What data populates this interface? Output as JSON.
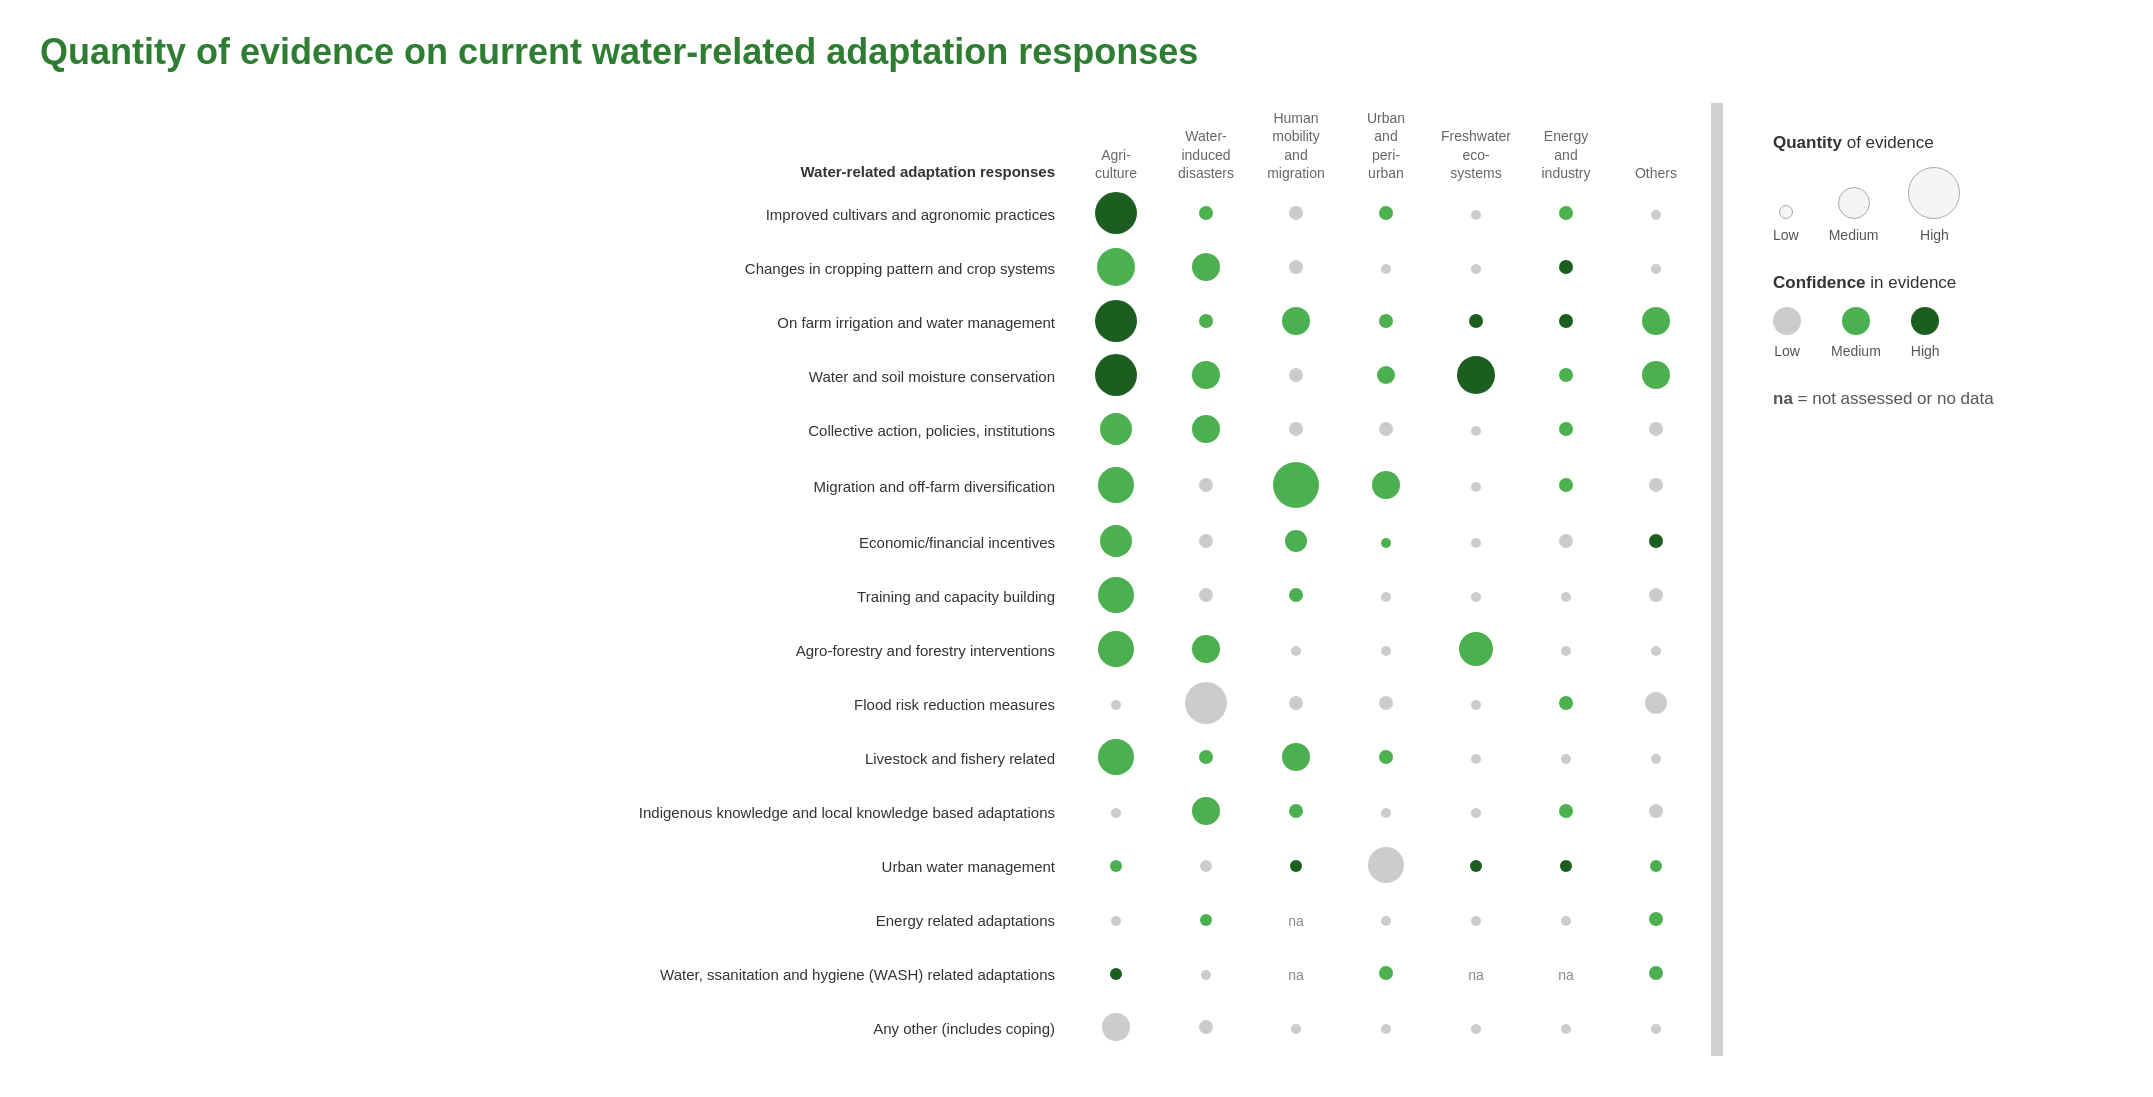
{
  "title": "Quantity of evidence on current water-related adaptation responses",
  "columns": [
    {
      "id": "agri",
      "label": "Agri-\nculture"
    },
    {
      "id": "water_disasters",
      "label": "Water-\ninduced\ndisasters"
    },
    {
      "id": "human_mobility",
      "label": "Human\nmobility\nand\nmigration"
    },
    {
      "id": "urban",
      "label": "Urban\nand\nperi-\nurban"
    },
    {
      "id": "freshwater",
      "label": "Freshwater\neco-\nsystems"
    },
    {
      "id": "energy",
      "label": "Energy\nand\nindustry"
    },
    {
      "id": "others",
      "label": "Others"
    }
  ],
  "row_label_header": "Water-related adaptation responses",
  "rows": [
    {
      "label": "Improved cultivars and agronomic practices",
      "cells": [
        {
          "size": 42,
          "color": "dark-green"
        },
        {
          "size": 14,
          "color": "medium-green"
        },
        {
          "size": 14,
          "color": "light-gray"
        },
        {
          "size": 14,
          "color": "medium-green"
        },
        {
          "size": 10,
          "color": "light-gray"
        },
        {
          "size": 14,
          "color": "medium-green"
        },
        {
          "size": 10,
          "color": "light-gray"
        }
      ]
    },
    {
      "label": "Changes in cropping pattern and crop systems",
      "cells": [
        {
          "size": 38,
          "color": "medium-green"
        },
        {
          "size": 28,
          "color": "medium-green"
        },
        {
          "size": 14,
          "color": "light-gray"
        },
        {
          "size": 10,
          "color": "light-gray"
        },
        {
          "size": 10,
          "color": "light-gray"
        },
        {
          "size": 14,
          "color": "dark-green"
        },
        {
          "size": 10,
          "color": "light-gray"
        }
      ]
    },
    {
      "label": "On farm irrigation and water management",
      "cells": [
        {
          "size": 42,
          "color": "dark-green"
        },
        {
          "size": 14,
          "color": "medium-green"
        },
        {
          "size": 28,
          "color": "medium-green"
        },
        {
          "size": 14,
          "color": "medium-green"
        },
        {
          "size": 14,
          "color": "dark-green"
        },
        {
          "size": 14,
          "color": "dark-green"
        },
        {
          "size": 28,
          "color": "medium-green"
        }
      ]
    },
    {
      "label": "Water and soil moisture conservation",
      "cells": [
        {
          "size": 42,
          "color": "dark-green"
        },
        {
          "size": 28,
          "color": "medium-green"
        },
        {
          "size": 14,
          "color": "light-gray"
        },
        {
          "size": 18,
          "color": "medium-green"
        },
        {
          "size": 38,
          "color": "dark-green"
        },
        {
          "size": 14,
          "color": "medium-green"
        },
        {
          "size": 28,
          "color": "medium-green"
        }
      ]
    },
    {
      "label": "Collective action, policies, institutions",
      "cells": [
        {
          "size": 32,
          "color": "medium-green"
        },
        {
          "size": 28,
          "color": "medium-green"
        },
        {
          "size": 14,
          "color": "light-gray"
        },
        {
          "size": 14,
          "color": "light-gray"
        },
        {
          "size": 10,
          "color": "light-gray"
        },
        {
          "size": 14,
          "color": "medium-green"
        },
        {
          "size": 14,
          "color": "light-gray"
        }
      ]
    },
    {
      "label": "Migration and off-farm diversification",
      "cells": [
        {
          "size": 36,
          "color": "medium-green"
        },
        {
          "size": 14,
          "color": "light-gray"
        },
        {
          "size": 46,
          "color": "medium-green"
        },
        {
          "size": 28,
          "color": "medium-green"
        },
        {
          "size": 10,
          "color": "light-gray"
        },
        {
          "size": 14,
          "color": "medium-green"
        },
        {
          "size": 14,
          "color": "light-gray"
        }
      ]
    },
    {
      "label": "Economic/financial incentives",
      "cells": [
        {
          "size": 32,
          "color": "medium-green"
        },
        {
          "size": 14,
          "color": "light-gray"
        },
        {
          "size": 22,
          "color": "medium-green"
        },
        {
          "size": 10,
          "color": "medium-green"
        },
        {
          "size": 10,
          "color": "light-gray"
        },
        {
          "size": 14,
          "color": "light-gray"
        },
        {
          "size": 14,
          "color": "dark-green"
        }
      ]
    },
    {
      "label": "Training and capacity building",
      "cells": [
        {
          "size": 36,
          "color": "medium-green"
        },
        {
          "size": 14,
          "color": "light-gray"
        },
        {
          "size": 14,
          "color": "medium-green"
        },
        {
          "size": 10,
          "color": "light-gray"
        },
        {
          "size": 10,
          "color": "light-gray"
        },
        {
          "size": 10,
          "color": "light-gray"
        },
        {
          "size": 14,
          "color": "light-gray"
        }
      ]
    },
    {
      "label": "Agro-forestry and forestry interventions",
      "cells": [
        {
          "size": 36,
          "color": "medium-green"
        },
        {
          "size": 28,
          "color": "medium-green"
        },
        {
          "size": 10,
          "color": "light-gray"
        },
        {
          "size": 10,
          "color": "light-gray"
        },
        {
          "size": 34,
          "color": "medium-green"
        },
        {
          "size": 10,
          "color": "light-gray"
        },
        {
          "size": 10,
          "color": "light-gray"
        }
      ]
    },
    {
      "label": "Flood risk reduction measures",
      "cells": [
        {
          "size": 10,
          "color": "light-gray"
        },
        {
          "size": 42,
          "color": "light-gray"
        },
        {
          "size": 14,
          "color": "light-gray"
        },
        {
          "size": 14,
          "color": "light-gray"
        },
        {
          "size": 10,
          "color": "light-gray"
        },
        {
          "size": 14,
          "color": "medium-green"
        },
        {
          "size": 22,
          "color": "light-gray"
        }
      ]
    },
    {
      "label": "Livestock and fishery related",
      "cells": [
        {
          "size": 36,
          "color": "medium-green"
        },
        {
          "size": 14,
          "color": "medium-green"
        },
        {
          "size": 28,
          "color": "medium-green"
        },
        {
          "size": 14,
          "color": "medium-green"
        },
        {
          "size": 10,
          "color": "light-gray"
        },
        {
          "size": 10,
          "color": "light-gray"
        },
        {
          "size": 10,
          "color": "light-gray"
        }
      ]
    },
    {
      "label": "Indigenous knowledge and local knowledge based adaptations",
      "cells": [
        {
          "size": 10,
          "color": "light-gray"
        },
        {
          "size": 28,
          "color": "medium-green"
        },
        {
          "size": 14,
          "color": "medium-green"
        },
        {
          "size": 10,
          "color": "light-gray"
        },
        {
          "size": 10,
          "color": "light-gray"
        },
        {
          "size": 14,
          "color": "medium-green"
        },
        {
          "size": 14,
          "color": "light-gray"
        }
      ]
    },
    {
      "label": "Urban water management",
      "cells": [
        {
          "size": 12,
          "color": "medium-green"
        },
        {
          "size": 12,
          "color": "light-gray"
        },
        {
          "size": 12,
          "color": "dark-green"
        },
        {
          "size": 36,
          "color": "light-gray"
        },
        {
          "size": 12,
          "color": "dark-green"
        },
        {
          "size": 12,
          "color": "dark-green"
        },
        {
          "size": 12,
          "color": "medium-green"
        }
      ]
    },
    {
      "label": "Energy related adaptations",
      "cells": [
        {
          "size": 10,
          "color": "light-gray"
        },
        {
          "size": 12,
          "color": "medium-green"
        },
        {
          "na": true
        },
        {
          "size": 10,
          "color": "light-gray"
        },
        {
          "size": 10,
          "color": "light-gray"
        },
        {
          "size": 10,
          "color": "light-gray"
        },
        {
          "size": 14,
          "color": "medium-green"
        }
      ]
    },
    {
      "label": "Water, ssanitation and hygiene (WASH) related adaptations",
      "cells": [
        {
          "size": 12,
          "color": "dark-green"
        },
        {
          "size": 10,
          "color": "light-gray"
        },
        {
          "na": true
        },
        {
          "size": 14,
          "color": "medium-green"
        },
        {
          "na": true
        },
        {
          "na": true
        },
        {
          "size": 14,
          "color": "medium-green"
        }
      ]
    },
    {
      "label": "Any other (includes coping)",
      "cells": [
        {
          "size": 28,
          "color": "light-gray"
        },
        {
          "size": 14,
          "color": "light-gray"
        },
        {
          "size": 10,
          "color": "light-gray"
        },
        {
          "size": 10,
          "color": "light-gray"
        },
        {
          "size": 10,
          "color": "light-gray"
        },
        {
          "size": 10,
          "color": "light-gray"
        },
        {
          "size": 10,
          "color": "light-gray"
        }
      ]
    }
  ],
  "legend": {
    "quantity_title": "Quantity",
    "quantity_subtitle": " of evidence",
    "quantity_items": [
      {
        "label": "Low",
        "size": 14
      },
      {
        "label": "Medium",
        "size": 32
      },
      {
        "label": "High",
        "size": 52
      }
    ],
    "confidence_title": "Confidence",
    "confidence_subtitle": " in evidence",
    "confidence_items": [
      {
        "label": "Low",
        "color": "light-gray",
        "size": 28
      },
      {
        "label": "Medium",
        "color": "medium-green",
        "size": 28
      },
      {
        "label": "High",
        "color": "dark-green",
        "size": 28
      }
    ],
    "na_label": "na",
    "na_equals": " = not assessed or no data"
  }
}
